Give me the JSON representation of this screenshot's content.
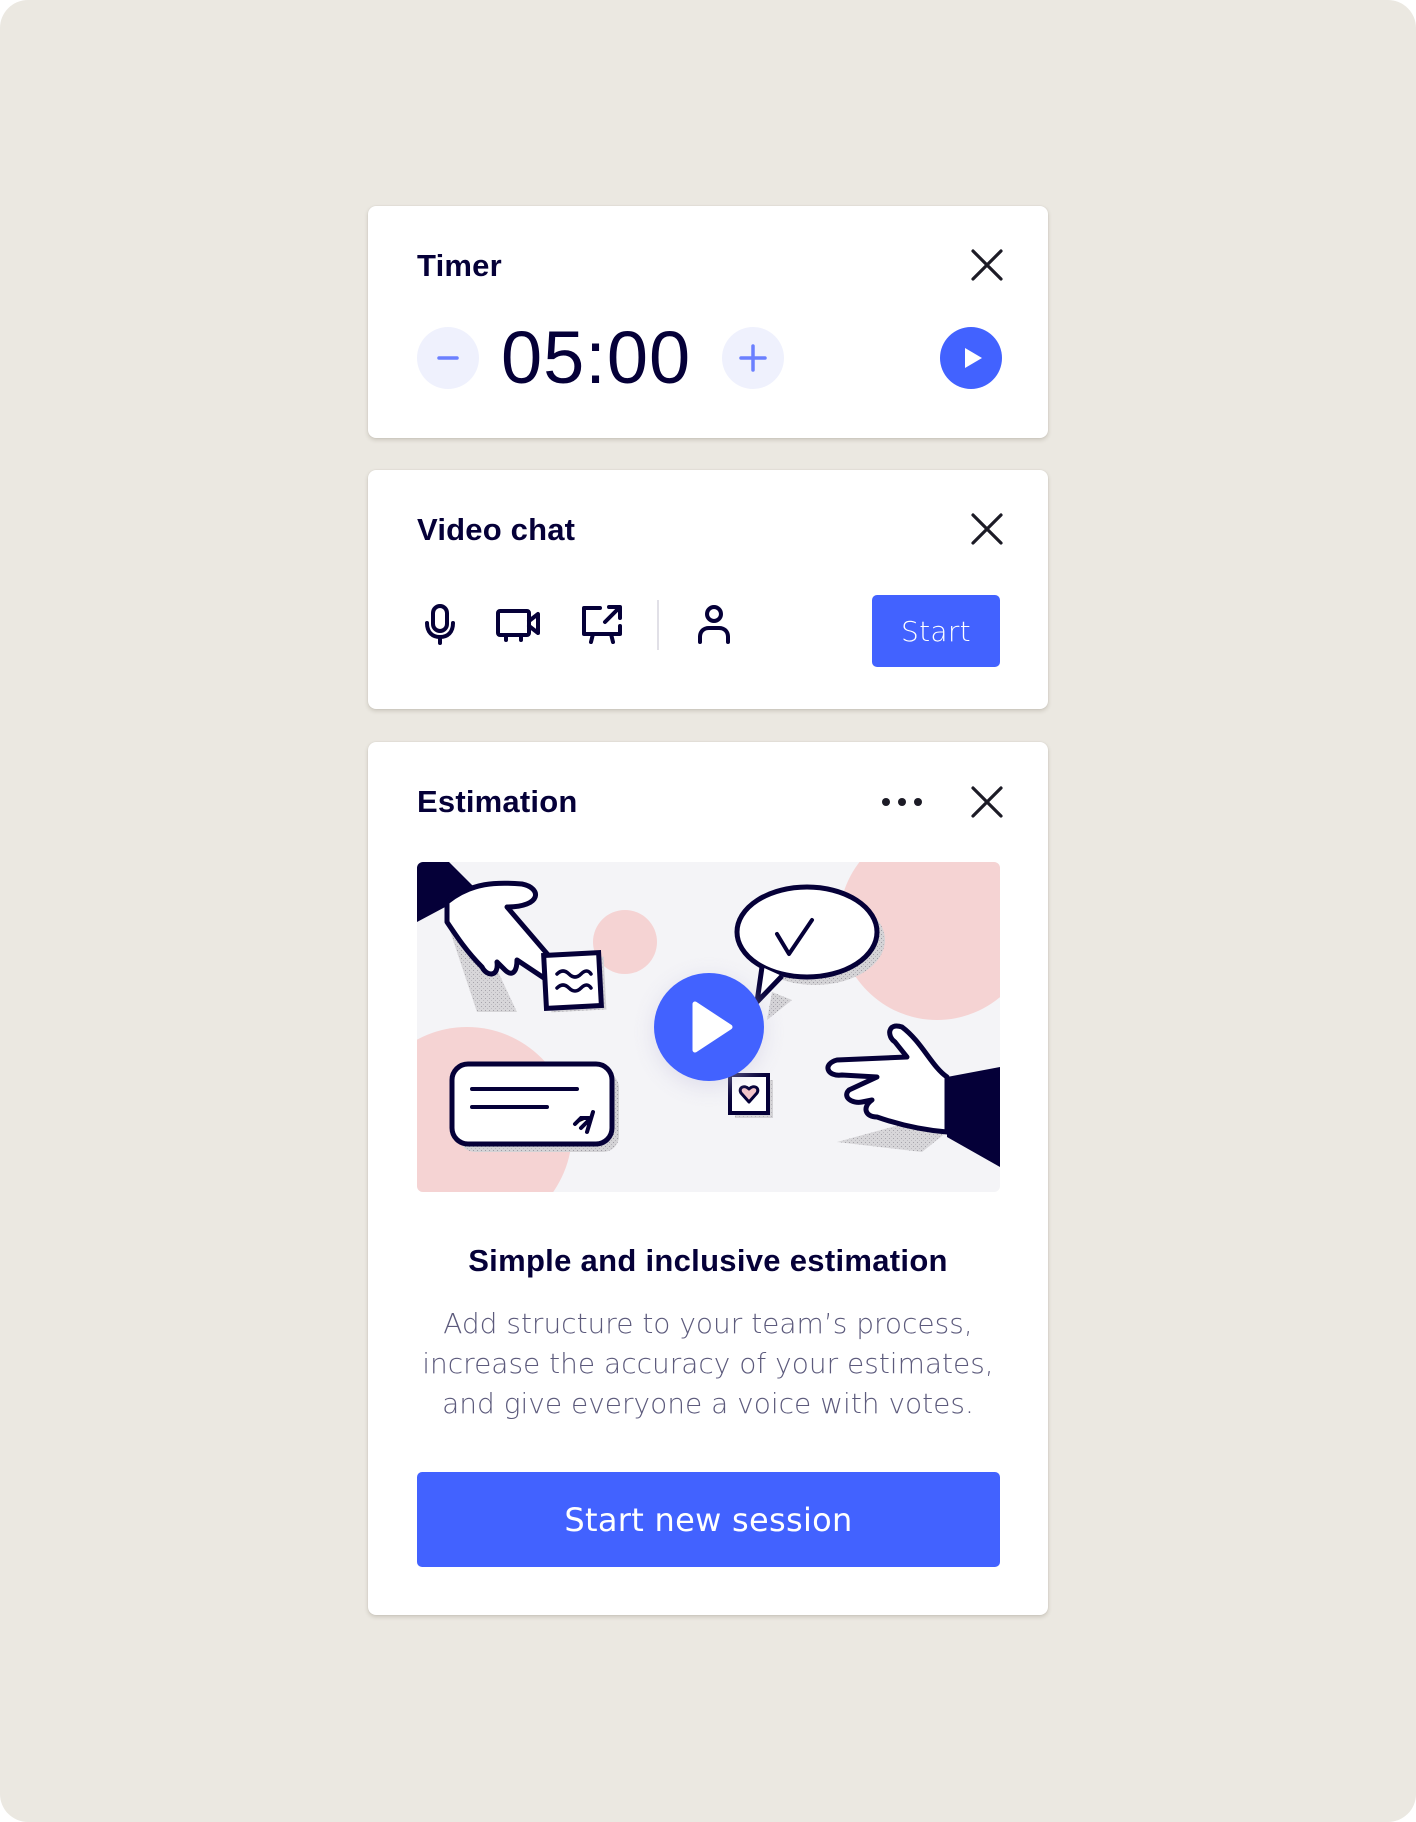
{
  "colors": {
    "background": "#ebe8e1",
    "card": "#ffffff",
    "accent": "#4262ff",
    "title_text": "#050038",
    "body_text": "#5c5a7c",
    "stepper_bg": "#eff1fd",
    "stepper_glyph": "#6b80ff",
    "illustration_pink": "#f5d3d3"
  },
  "timer": {
    "title": "Timer",
    "value": "05:00",
    "icons": {
      "close": "close-icon",
      "decrease": "minus-icon",
      "increase": "plus-icon",
      "play": "play-icon"
    }
  },
  "video_chat": {
    "title": "Video chat",
    "start_label": "Start",
    "icons": {
      "close": "close-icon",
      "microphone": "microphone-icon",
      "camera": "video-camera-icon",
      "share_screen": "share-screen-icon",
      "participants": "person-icon"
    }
  },
  "estimation": {
    "title": "Estimation",
    "heading": "Simple and inclusive estimation",
    "description": "Add structure to your team’s process, increase the accuracy of your estimates, and give everyone a voice with votes.",
    "cta_label": "Start new session",
    "icons": {
      "more": "more-horizontal-icon",
      "close": "close-icon",
      "video_play": "play-icon"
    }
  }
}
